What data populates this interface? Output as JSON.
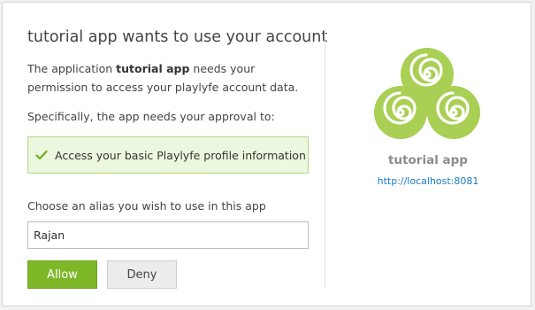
{
  "dialog": {
    "heading": "tutorial app wants to use your account",
    "description_prefix": "The application ",
    "app_name_bold": "tutorial app",
    "description_suffix": " needs your permission to access your playlyfe account data.",
    "specifically_text": "Specifically, the app needs your approval to:",
    "permissions": [
      {
        "icon": "checkmark-icon",
        "label": "Access your basic Playlyfe profile information"
      }
    ],
    "alias_label": "Choose an alias you wish to use in this app",
    "alias_value": "Rajan",
    "allow_label": "Allow",
    "deny_label": "Deny"
  },
  "app_panel": {
    "logo_icon": "triskelion-spiral-logo",
    "app_name": "tutorial app",
    "app_url": "http://localhost:8081"
  },
  "colors": {
    "accent_green": "#7eb829",
    "logo_green": "#a9cf54",
    "permission_bg": "#ecf7df",
    "link_blue": "#1a78c2"
  }
}
